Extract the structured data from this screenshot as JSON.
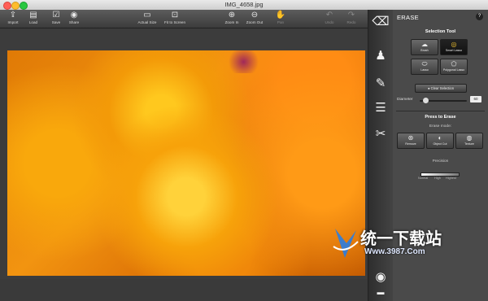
{
  "window": {
    "title": "IMG_4658.jpg"
  },
  "toolbar": {
    "import": {
      "label": "Import",
      "icon": "import-icon"
    },
    "load": {
      "label": "Load",
      "icon": "folder-icon"
    },
    "save": {
      "label": "Save",
      "icon": "save-icon"
    },
    "share": {
      "label": "Share",
      "icon": "share-icon"
    },
    "actual_size": {
      "label": "Actual Size",
      "icon": "actual-size-icon"
    },
    "fit_to_screen": {
      "label": "Fit to Screen",
      "icon": "fit-screen-icon"
    },
    "zoom_in": {
      "label": "Zoom In",
      "icon": "zoom-in-icon"
    },
    "zoom_out": {
      "label": "Zoom Out",
      "icon": "zoom-out-icon"
    },
    "pan": {
      "label": "Pan",
      "icon": "hand-icon"
    },
    "undo": {
      "label": "Undo",
      "icon": "undo-icon"
    },
    "redo": {
      "label": "Redo",
      "icon": "redo-icon"
    }
  },
  "panel": {
    "title": "ERASE",
    "help": "?",
    "selection_tool": {
      "heading": "Selection Tool",
      "tools": [
        {
          "label": "Brush",
          "selected": false
        },
        {
          "label": "Smart Lasso",
          "selected": true
        },
        {
          "label": "Lasso",
          "selected": false
        },
        {
          "label": "Polygonal Lasso",
          "selected": false
        }
      ]
    },
    "clear_button": "Clear Selection",
    "diameter": {
      "label": "Diameter",
      "value": "60"
    },
    "press_to_erase": {
      "heading": "Press to Erase",
      "mode_label": "Erase mode:",
      "modes": [
        {
          "label": "Remove"
        },
        {
          "label": "Object Cut"
        },
        {
          "label": "Texture"
        }
      ]
    },
    "precision": {
      "label": "Precision",
      "levels": [
        "Normal",
        "High",
        "Highest"
      ]
    }
  },
  "watermark": {
    "text_cn": "统一下载站",
    "url": "Www.3987.Com"
  },
  "colors": {
    "selected_tool": "#1a1a1a",
    "photo_orange": "#f39a08"
  }
}
